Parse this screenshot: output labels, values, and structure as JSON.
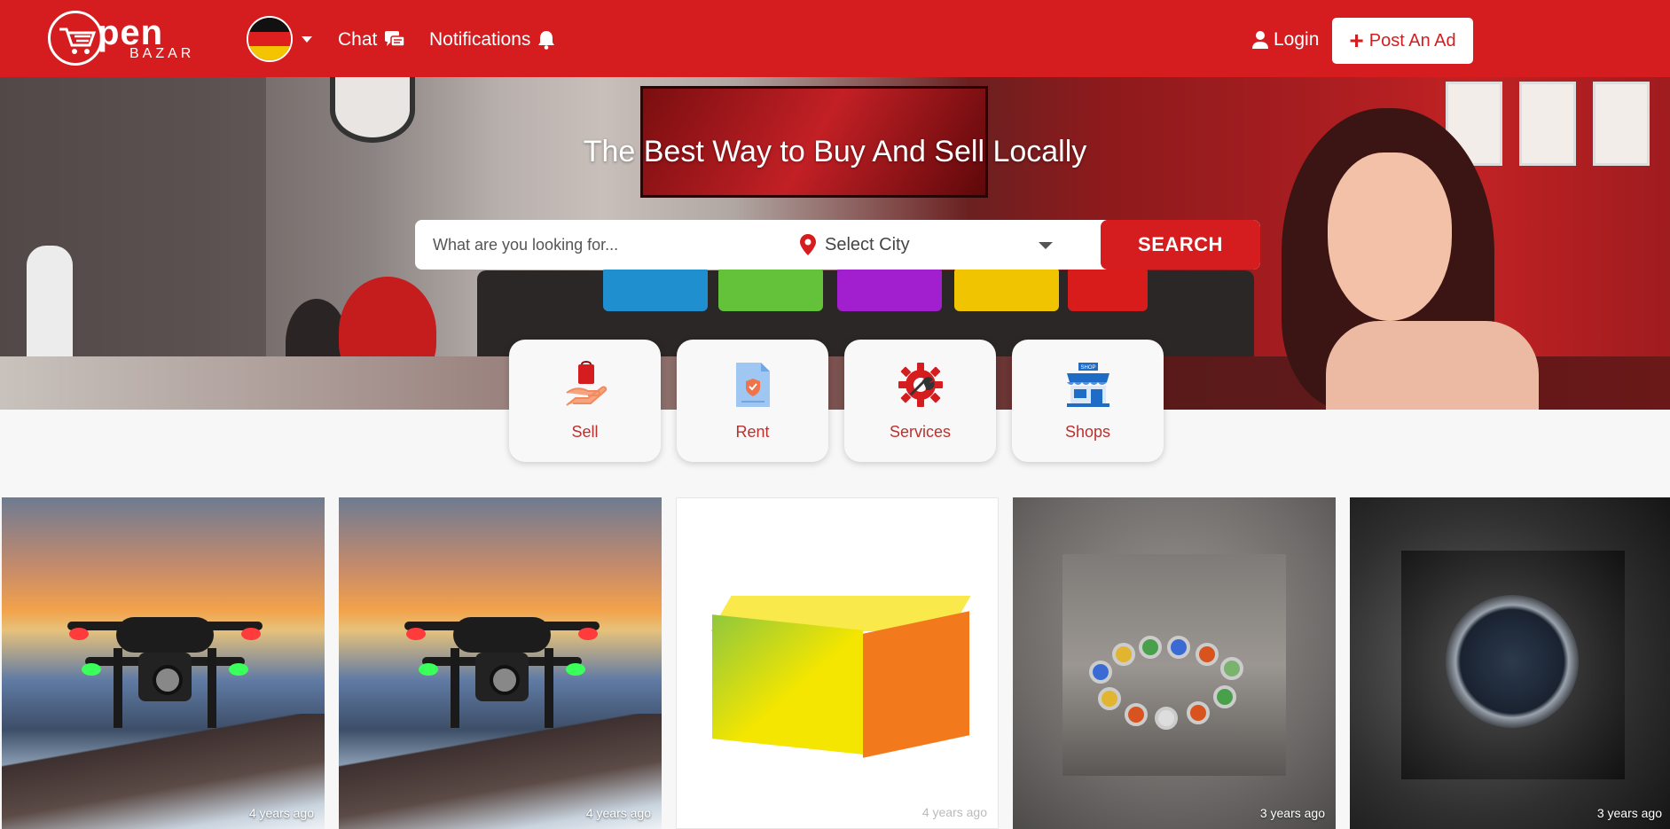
{
  "header": {
    "logo_big": "pen",
    "logo_small": "BAZAR",
    "chat_label": "Chat",
    "notifications_label": "Notifications",
    "login_label": "Login",
    "post_ad_label": "Post An Ad",
    "accent_color": "#d51c1f"
  },
  "hero": {
    "title": "The Best Way to Buy And Sell Locally",
    "search_placeholder": "What are you looking for...",
    "city_label": "Select City",
    "search_button": "SEARCH"
  },
  "categories": [
    {
      "label": "Sell",
      "icon": "sell-hand-bag-icon"
    },
    {
      "label": "Rent",
      "icon": "rent-document-icon"
    },
    {
      "label": "Services",
      "icon": "services-gear-icon"
    },
    {
      "label": "Shops",
      "icon": "shop-store-icon"
    }
  ],
  "listings": [
    {
      "time": "4 years ago",
      "image": "drone"
    },
    {
      "time": "4 years ago",
      "image": "drone"
    },
    {
      "time": "4 years ago",
      "image": "product-box"
    },
    {
      "time": "3 years ago",
      "image": "bracelet"
    },
    {
      "time": "3 years ago",
      "image": "watch"
    }
  ]
}
